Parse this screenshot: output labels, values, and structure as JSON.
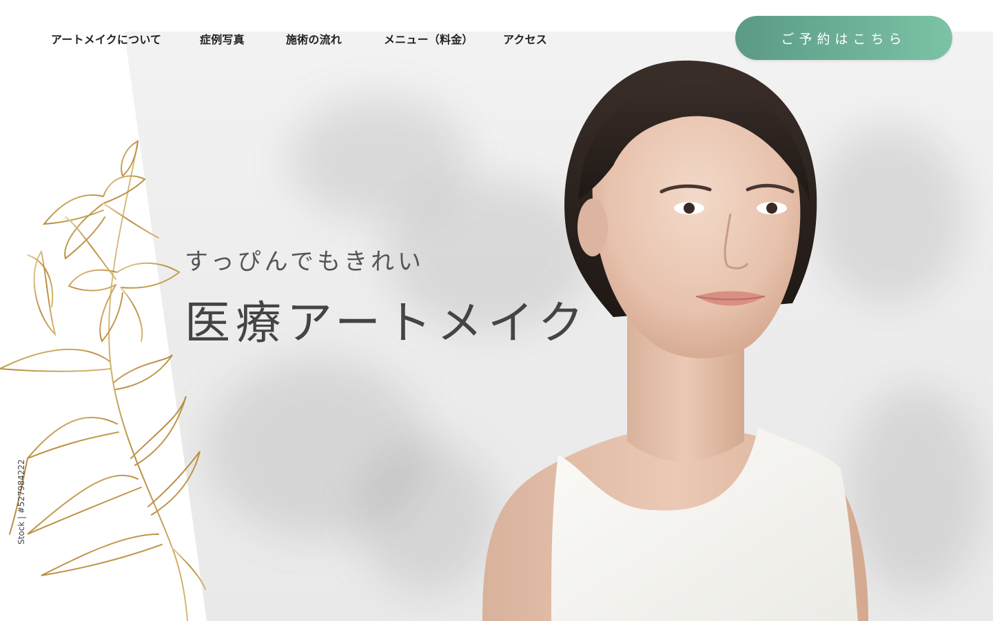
{
  "nav": {
    "items": [
      {
        "label": "アートメイクについて"
      },
      {
        "label": "症例写真"
      },
      {
        "label": "施術の流れ"
      },
      {
        "label": "メニュー（料金）"
      },
      {
        "label": "アクセス"
      }
    ]
  },
  "cta": {
    "label": "ご予約はこちら",
    "color_start": "#5b9a86",
    "color_end": "#7cc3a5"
  },
  "hero": {
    "subtitle": "すっぴんでもきれい",
    "title": "医療アートメイク"
  },
  "image": {
    "stock_id": "Stock | #527984222"
  },
  "colors": {
    "gold": "#c9a55a",
    "text": "#222222"
  }
}
